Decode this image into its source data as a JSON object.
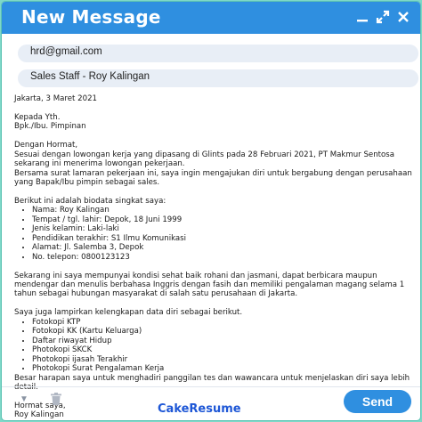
{
  "window": {
    "title": "New Message",
    "controls": [
      "minimize-icon",
      "expand-icon",
      "close-icon"
    ]
  },
  "to_field": {
    "value": "hrd@gmail.com"
  },
  "subject_field": {
    "value": "Sales Staff - Roy Kalingan"
  },
  "letter": {
    "date": "Jakarta, 3 Maret 2021",
    "recipient_1": "Kepada Yth.",
    "recipient_2": "Bpk./Ibu. Pimpinan",
    "greeting": "Dengan Hormat,",
    "intro_1": "Sesuai dengan lowongan kerja yang dipasang di Glints pada 28 Februari 2021, PT Makmur Sentosa sekarang ini menerima lowongan pekerjaan.",
    "intro_2": "Bersama surat lamaran pekerjaan ini, saya ingin mengajukan diri untuk bergabung dengan perusahaan yang Bapak/Ibu pimpin sebagai sales.",
    "bio_heading": "Berikut ini adalah biodata singkat saya:",
    "bio_items": [
      "Nama: Roy Kalingan",
      "Tempat / tgl. lahir: Depok, 18 Juni 1999",
      "Jenis kelamin: Laki-laki",
      "Pendidikan terakhir: S1 Ilmu Komunikasi",
      "Alamat: Jl. Salemba 3, Depok",
      "No. telepon: 0800123123"
    ],
    "body_para": "Sekarang ini saya mempunyai kondisi sehat baik rohani dan jasmani, dapat berbicara maupun mendengar dan menulis berbahasa Inggris dengan fasih dan memiliki pengalaman magang selama 1 tahun sebagai hubungan masyarakat di salah satu perusahaan di Jakarta.",
    "attach_heading": "Saya juga lampirkan kelengkapan data diri sebagai berikut.",
    "attach_items": [
      "Fotokopi KTP",
      "Fotokopi KK (Kartu Keluarga)",
      "Daftar riwayat Hidup",
      "Photokopi SKCK",
      "Photokopi ijasah Terakhir",
      "Photokopi Surat Pengalaman Kerja"
    ],
    "closing_para": "Besar harapan saya untuk menghadiri panggilan tes dan wawancara untuk menjelaskan diri saya lebih detail.",
    "sign_off": "Hormat saya,",
    "sign_name": "Roy Kalingan"
  },
  "footer": {
    "brand": "CakeResume",
    "send_label": "Send"
  },
  "colors": {
    "accent": "#2f8fe0",
    "field_bg": "#e8eef6",
    "frame": "#7fd8c8",
    "brand": "#1e57d6"
  }
}
